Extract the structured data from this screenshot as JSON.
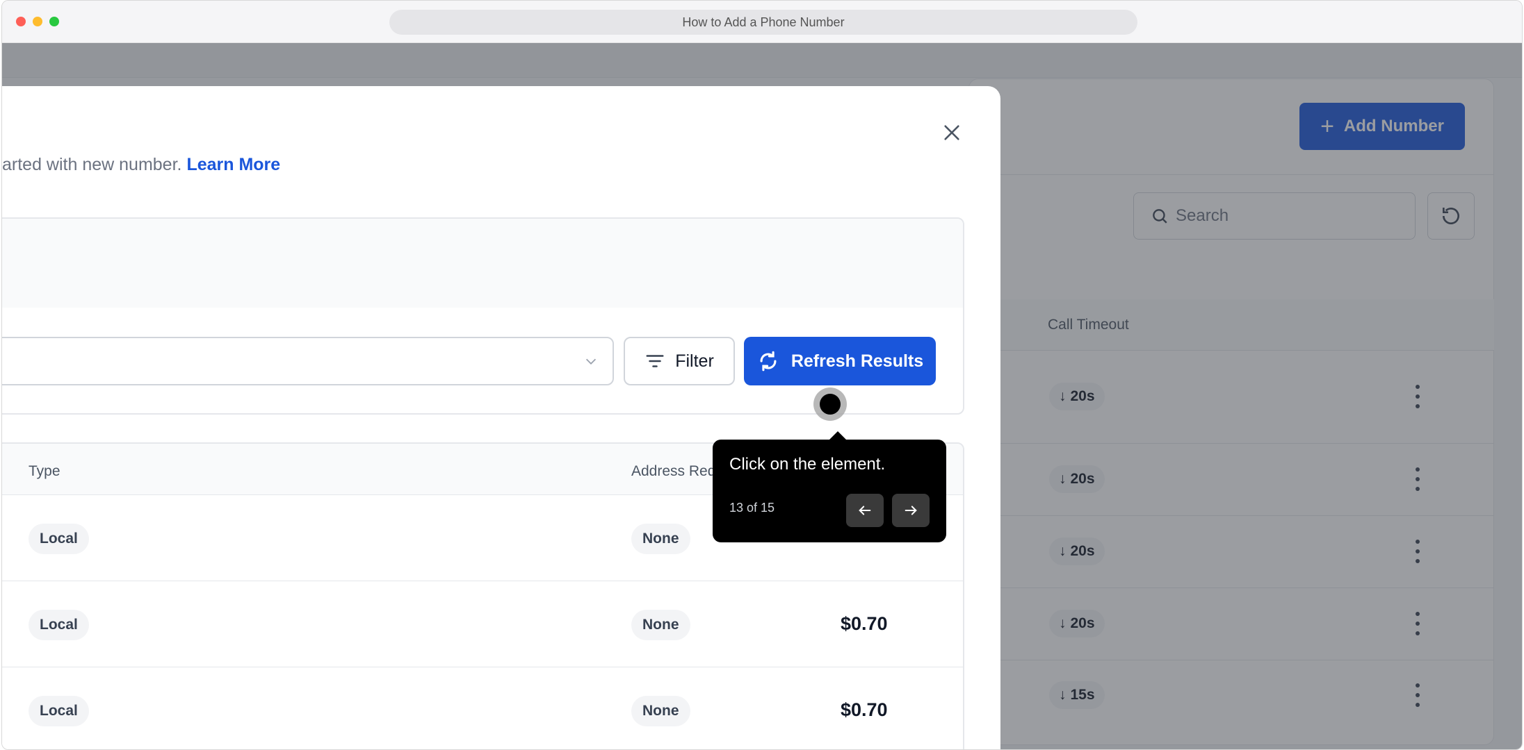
{
  "window": {
    "url_title": "How to Add a Phone Number"
  },
  "background": {
    "add_number_label": "Add Number",
    "search_placeholder": "Search",
    "column_call_timeout": "Call Timeout",
    "rows": [
      {
        "timeout": "20s"
      },
      {
        "timeout": "20s"
      },
      {
        "timeout": "20s"
      },
      {
        "timeout": "20s"
      },
      {
        "timeout": "15s"
      }
    ]
  },
  "modal": {
    "intro_text": "arted with new number.",
    "learn_more": "Learn More",
    "filter_label": "Filter",
    "refresh_label": "Refresh Results",
    "table": {
      "headers": {
        "type": "Type",
        "address": "Address Req"
      },
      "rows": [
        {
          "type": "Local",
          "address": "None",
          "price": ""
        },
        {
          "type": "Local",
          "address": "None",
          "price": "$0.70"
        },
        {
          "type": "Local",
          "address": "None",
          "price": "$0.70"
        }
      ]
    }
  },
  "guide": {
    "instruction": "Click on the element.",
    "step": "13 of 15"
  },
  "colors": {
    "primary": "#1a56db",
    "tooltip_bg": "#000000"
  }
}
